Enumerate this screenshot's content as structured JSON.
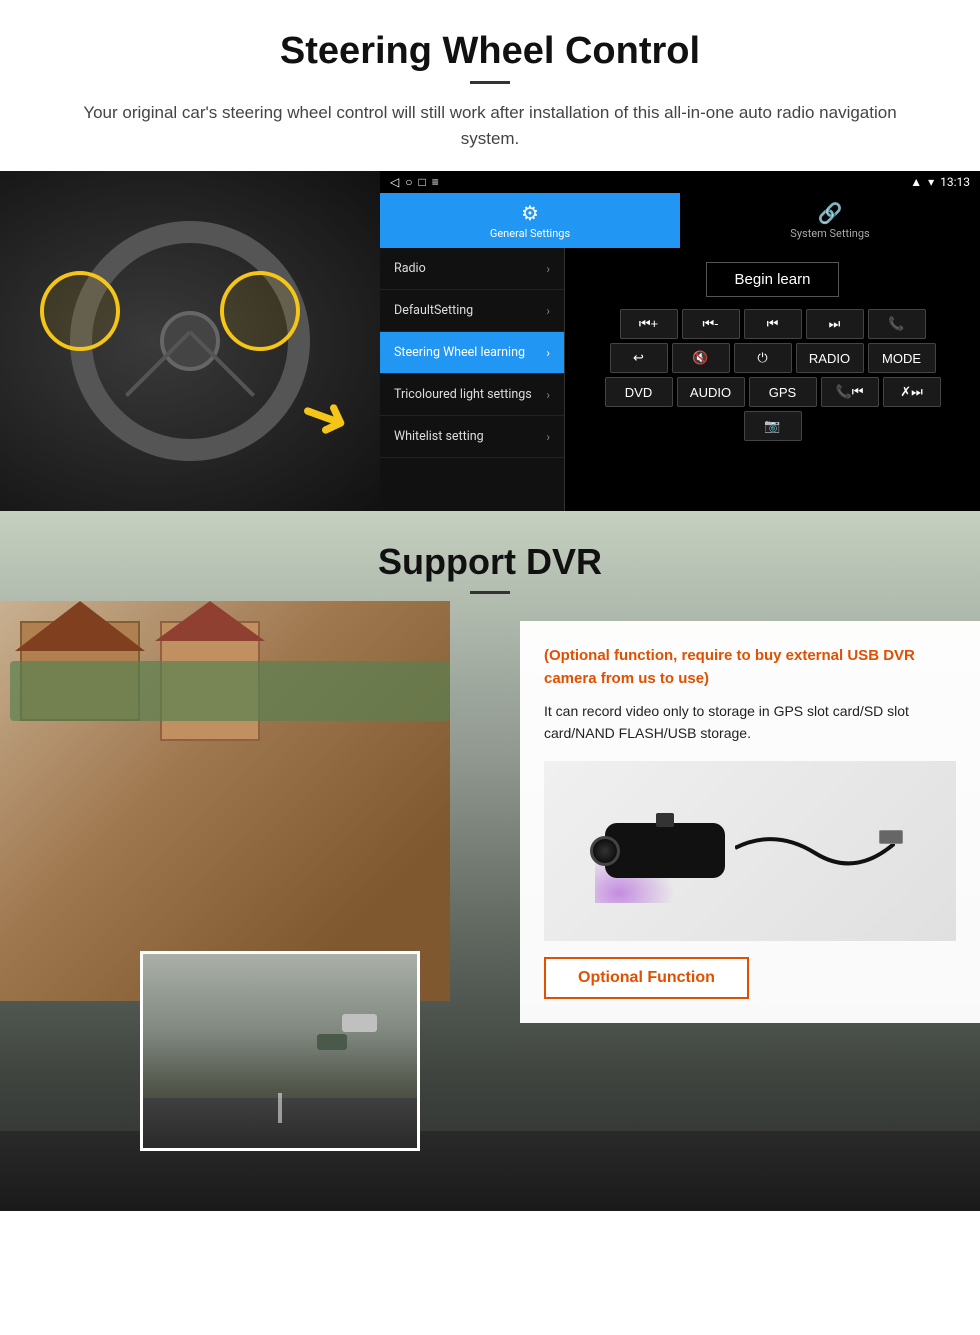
{
  "steering_section": {
    "title": "Steering Wheel Control",
    "subtitle": "Your original car's steering wheel control will still work after installation of this all-in-one auto radio navigation system.",
    "statusbar": {
      "time": "13:13",
      "wifi_icon": "▾",
      "signal_icon": "▴"
    },
    "tabs": [
      {
        "id": "general",
        "icon": "⚙",
        "label": "General Settings",
        "active": true
      },
      {
        "id": "system",
        "icon": "🔗",
        "label": "System Settings",
        "active": false
      }
    ],
    "menu_items": [
      {
        "id": "radio",
        "label": "Radio",
        "active": false
      },
      {
        "id": "default",
        "label": "DefaultSetting",
        "active": false
      },
      {
        "id": "steering",
        "label": "Steering Wheel learning",
        "active": true
      },
      {
        "id": "tricoloured",
        "label": "Tricoloured light settings",
        "active": false
      },
      {
        "id": "whitelist",
        "label": "Whitelist setting",
        "active": false
      }
    ],
    "begin_learn_label": "Begin learn",
    "control_buttons": {
      "row1": [
        "⏮+",
        "⏮-",
        "⏮",
        "⏭",
        "📞"
      ],
      "row2": [
        "↩",
        "🔇",
        "⏻",
        "RADIO",
        "MODE"
      ],
      "row3": [
        "DVD",
        "AUDIO",
        "GPS",
        "📞⏮",
        "✗⏭"
      ],
      "row4": [
        "📷"
      ]
    }
  },
  "dvr_section": {
    "title": "Support DVR",
    "optional_text": "(Optional function, require to buy external USB DVR camera from us to use)",
    "description": "It can record video only to storage in GPS slot card/SD slot card/NAND FLASH/USB storage.",
    "optional_function_label": "Optional Function"
  }
}
